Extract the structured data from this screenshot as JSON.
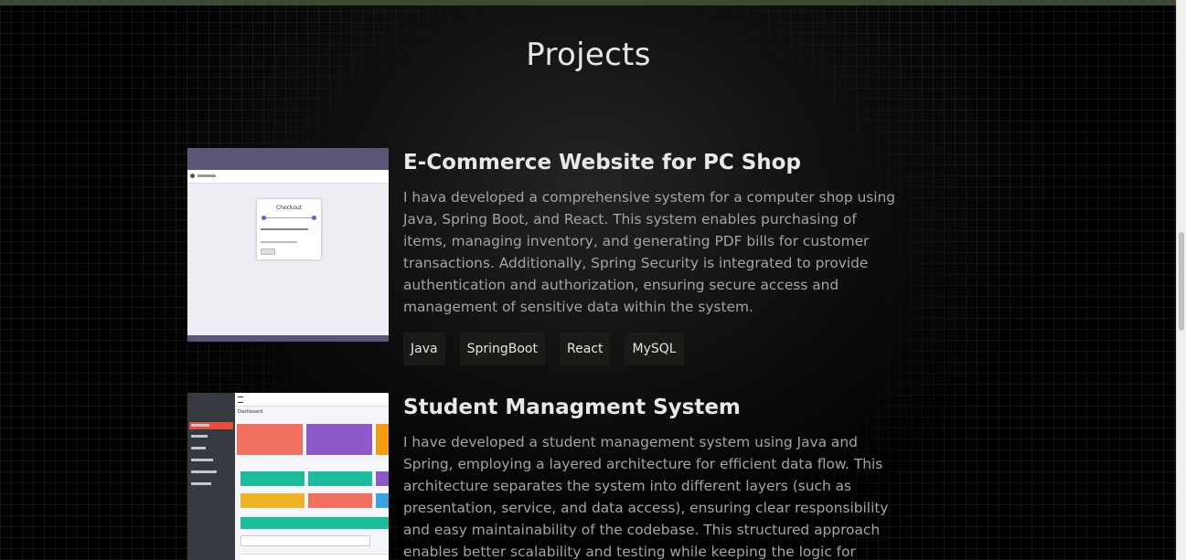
{
  "section": {
    "title": "Projects"
  },
  "projects": [
    {
      "title": "E-Commerce Website for PC Shop",
      "description": "I hava developed a comprehensive system for a computer shop using Java, Spring Boot, and React. This system enables purchasing of items, managing inventory, and generating PDF bills for customer transactions. Additionally, Spring Security is integrated to provide authentication and authorization, ensuring secure access and management of sensitive data within the system.",
      "tags": [
        "Java",
        "SpringBoot",
        "React",
        "MySQL"
      ],
      "thumbnail": {
        "card_title": "Checkout"
      }
    },
    {
      "title": "Student Managment System",
      "description": "I have developed a student management system using Java and Spring, employing a layered architecture for efficient data flow. This architecture separates the system into different layers (such as presentation, service, and data access), ensuring clear responsibility and easy maintainability of the codebase. This structured approach enables better scalability and testing while keeping the logic for handling student data organized and",
      "tags": [],
      "thumbnail": {
        "dashboard_title": "Dashboard"
      }
    }
  ],
  "colors": {
    "background": "#000000",
    "top_bar": "#3b4a35",
    "tag_background": "#1c1a17",
    "title_text": "#e8e8e8",
    "body_text": "#a4a4a4"
  }
}
